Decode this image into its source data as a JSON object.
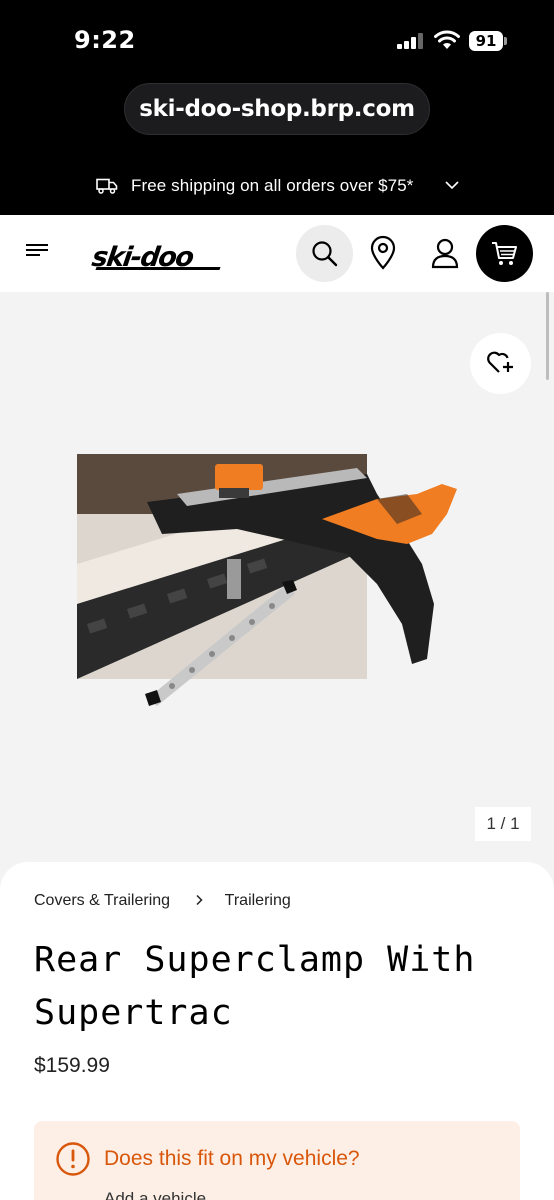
{
  "status_bar": {
    "time": "9:22",
    "battery": "91"
  },
  "browser": {
    "url": "ski-doo-shop.brp.com"
  },
  "promo": {
    "text": "Free shipping on all orders over $75*"
  },
  "header": {
    "logo": "ski-doo"
  },
  "gallery": {
    "counter": "1 / 1"
  },
  "product": {
    "breadcrumb": [
      "Covers & Trailering",
      "Trailering"
    ],
    "title": "Rear Superclamp With Supertrac",
    "price": "$159.99"
  },
  "fit": {
    "title": "Does this fit on my vehicle?",
    "subtitle": "Add a vehicle"
  },
  "colors": {
    "accent": "#d9570b",
    "fit_bg": "#fdefe6",
    "product_orange": "#f07d22"
  }
}
